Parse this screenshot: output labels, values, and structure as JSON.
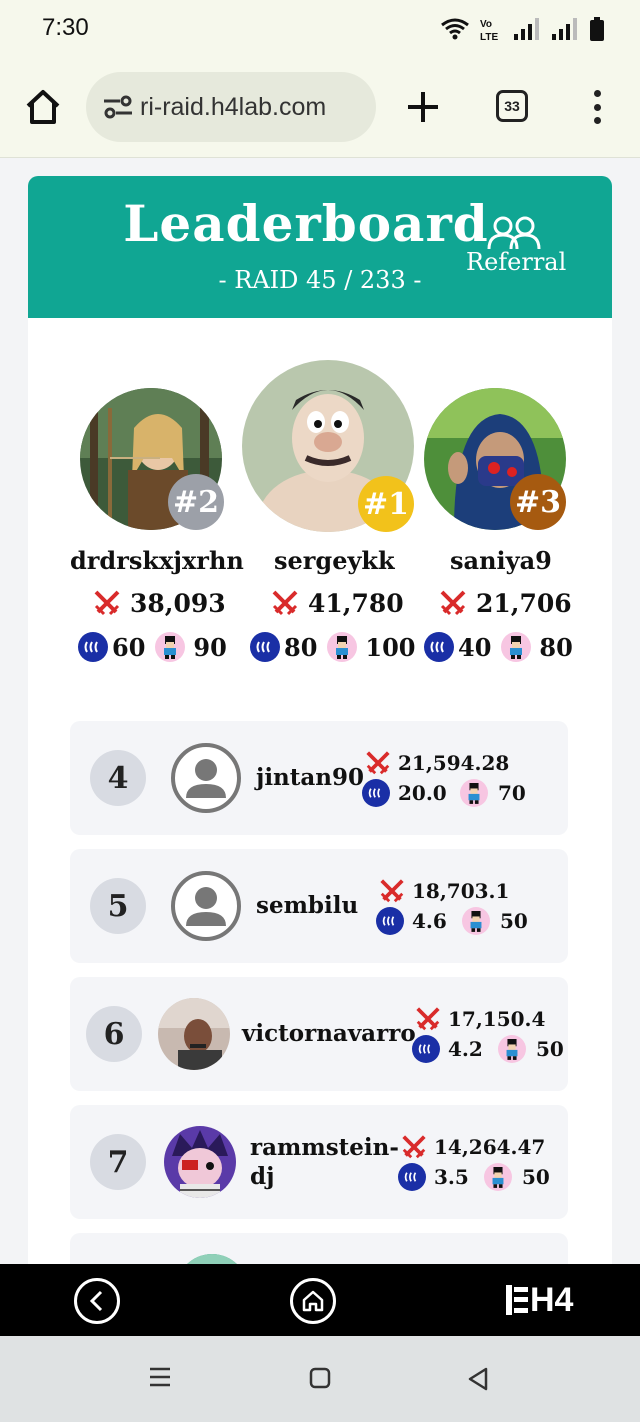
{
  "status_bar": {
    "time": "7:30",
    "volte": "VoLTE"
  },
  "browser": {
    "url": "ri-raid.h4lab.com",
    "tab_count": "33"
  },
  "header": {
    "title": "Leaderboard",
    "subtitle": "- RAID 45 / 233 -",
    "referral_label": "Referral",
    "bg_color": "#10a693"
  },
  "podium": [
    {
      "rank": "#2",
      "name": "drdrskxjxrhn",
      "score": "38,093",
      "steem": "60",
      "mini": "90",
      "badge_color": "#9ca0a8"
    },
    {
      "rank": "#1",
      "name": "sergeykk",
      "score": "41,780",
      "steem": "80",
      "mini": "100",
      "badge_color": "#f2c21b"
    },
    {
      "rank": "#3",
      "name": "saniya9",
      "score": "21,706",
      "steem": "40",
      "mini": "80",
      "badge_color": "#a65a10"
    }
  ],
  "rows": [
    {
      "rank": "4",
      "name": "jintan90",
      "score": "21,594.28",
      "steem": "20.0",
      "mini": "70",
      "avatar": "default"
    },
    {
      "rank": "5",
      "name": "sembilu",
      "score": "18,703.1",
      "steem": "4.6",
      "mini": "50",
      "avatar": "default"
    },
    {
      "rank": "6",
      "name": "victornavarro",
      "score": "17,150.4",
      "steem": "4.2",
      "mini": "50",
      "avatar": "photo"
    },
    {
      "rank": "7",
      "name_line1": "rammstein-",
      "name_line2": "dj",
      "score": "14,264.47",
      "steem": "3.5",
      "mini": "50",
      "avatar": "cartoon"
    }
  ],
  "app_nav": {
    "logo": "H4"
  }
}
